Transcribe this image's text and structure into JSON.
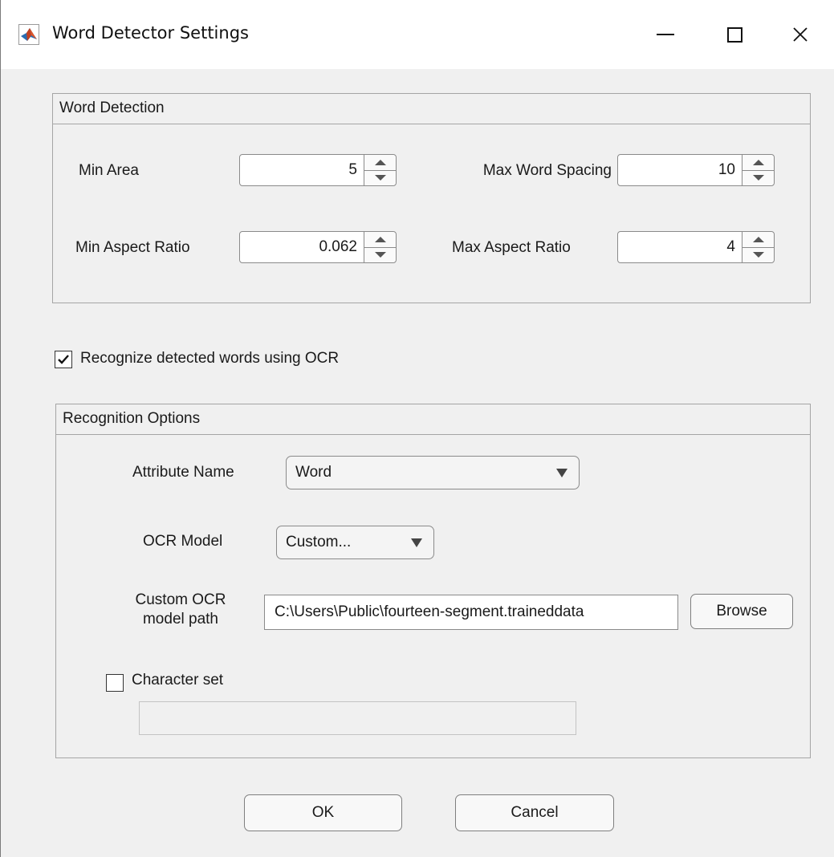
{
  "window": {
    "title": "Word Detector Settings",
    "controls": {
      "minimize": "—",
      "maximize": "☐",
      "close": "✕"
    }
  },
  "word_detection": {
    "title": "Word Detection",
    "min_area": {
      "label": "Min Area",
      "value": "5"
    },
    "max_word_spacing": {
      "label": "Max Word Spacing",
      "value": "10"
    },
    "min_aspect_ratio": {
      "label": "Min Aspect Ratio",
      "value": "0.062"
    },
    "max_aspect_ratio": {
      "label": "Max Aspect Ratio",
      "value": "4"
    }
  },
  "recognize_ocr": {
    "label": "Recognize detected words using OCR",
    "checked": true
  },
  "recognition_options": {
    "title": "Recognition Options",
    "attribute_name": {
      "label": "Attribute Name",
      "value": "Word"
    },
    "ocr_model": {
      "label": "OCR Model",
      "value": "Custom..."
    },
    "custom_model_path": {
      "label_line1": "Custom OCR",
      "label_line2": "model path",
      "value": "C:\\Users\\Public\\fourteen-segment.traineddata",
      "browse_label": "Browse"
    },
    "character_set": {
      "label": "Character set",
      "checked": false,
      "value": ""
    }
  },
  "buttons": {
    "ok": "OK",
    "cancel": "Cancel"
  },
  "icons": {
    "app": "matlab-logo-icon",
    "minimize": "minimize-icon",
    "maximize": "maximize-icon",
    "close": "close-icon",
    "spinner_up": "chevron-up-icon",
    "spinner_down": "chevron-down-icon",
    "dropdown": "dropdown-arrow-icon",
    "checkmark": "checkmark-icon"
  },
  "colors": {
    "window_bg": "#f0f0f0",
    "titlebar_bg": "#ffffff",
    "border": "#a5a5a5"
  }
}
